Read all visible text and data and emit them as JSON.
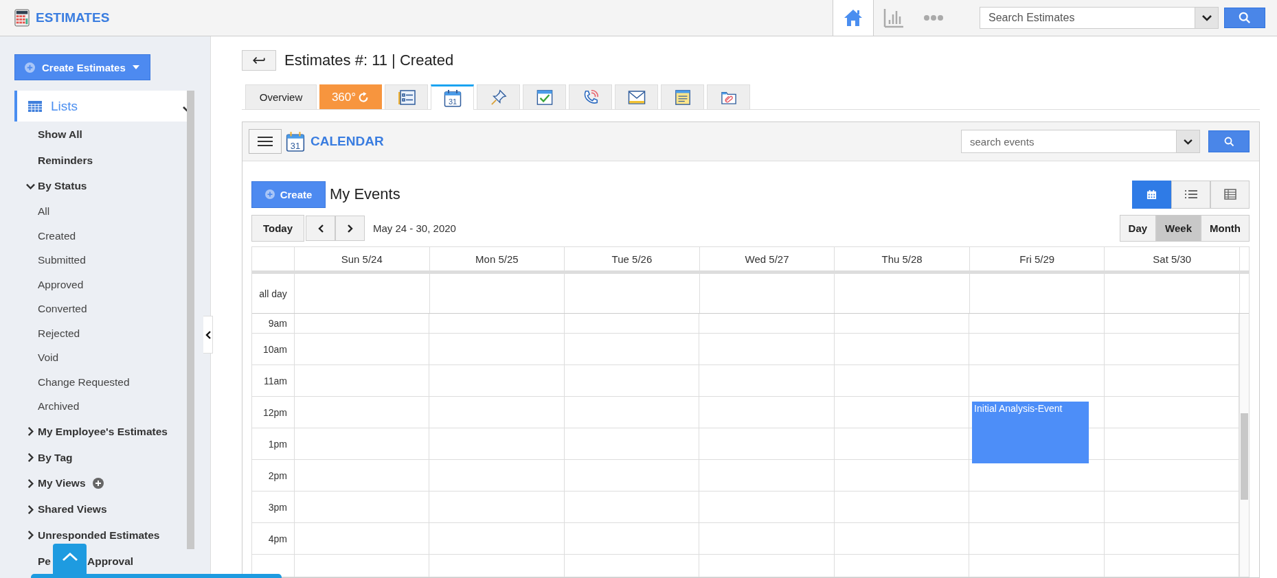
{
  "app": {
    "title": "ESTIMATES"
  },
  "topbar": {
    "nav": [
      {
        "kind": "home",
        "selected": true
      },
      {
        "kind": "chart",
        "selected": false
      },
      {
        "kind": "more",
        "selected": false
      }
    ],
    "search": {
      "placeholder": "Search Estimates"
    }
  },
  "sidebar": {
    "create_button": "Create Estimates",
    "section": {
      "label": "Lists",
      "expanded": true
    },
    "items": [
      {
        "label": "Show All",
        "kind": "link"
      },
      {
        "label": "Reminders",
        "kind": "link"
      },
      {
        "label": "By Status",
        "kind": "group",
        "expanded": true,
        "children": [
          {
            "label": "All"
          },
          {
            "label": "Created"
          },
          {
            "label": "Submitted"
          },
          {
            "label": "Approved"
          },
          {
            "label": "Converted"
          },
          {
            "label": "Rejected"
          },
          {
            "label": "Void"
          },
          {
            "label": "Change Requested"
          },
          {
            "label": "Archived"
          }
        ]
      },
      {
        "label": "My Employee's Estimates",
        "kind": "group",
        "expanded": false
      },
      {
        "label": "By Tag",
        "kind": "group",
        "expanded": false
      },
      {
        "label": "My Views",
        "kind": "group",
        "expanded": false,
        "addable": true
      },
      {
        "label": "Shared Views",
        "kind": "group",
        "expanded": false
      },
      {
        "label": "Unresponded Estimates",
        "kind": "group",
        "expanded": false
      },
      {
        "label_parts": [
          "Pe",
          "Approval"
        ],
        "kind": "covered"
      }
    ]
  },
  "record": {
    "title": "Estimates #: 11 | Created"
  },
  "tabs": [
    {
      "kind": "text",
      "label": "Overview",
      "selected": false
    },
    {
      "kind": "rotate",
      "label": "360°",
      "selected": false
    },
    {
      "kind": "details",
      "selected": false
    },
    {
      "kind": "calendar",
      "icon_text": "31",
      "selected": true
    },
    {
      "kind": "pin",
      "selected": false
    },
    {
      "kind": "task",
      "selected": false
    },
    {
      "kind": "call",
      "selected": false
    },
    {
      "kind": "mail",
      "selected": false
    },
    {
      "kind": "note",
      "selected": false
    },
    {
      "kind": "attachment",
      "selected": false
    }
  ],
  "calendar": {
    "title": "CALENDAR",
    "icon_text": "31",
    "search": {
      "placeholder": "search events"
    },
    "create_button": "Create",
    "heading": "My Events",
    "views": [
      {
        "kind": "calendar",
        "selected": true
      },
      {
        "kind": "list",
        "selected": false
      },
      {
        "kind": "table",
        "selected": false
      }
    ],
    "today_button": "Today",
    "range": "May 24 - 30, 2020",
    "range_modes": [
      {
        "label": "Day",
        "selected": false
      },
      {
        "label": "Week",
        "selected": true
      },
      {
        "label": "Month",
        "selected": false
      }
    ],
    "all_day_label": "all day",
    "days": [
      {
        "label": "Sun 5/24"
      },
      {
        "label": "Mon 5/25"
      },
      {
        "label": "Tue 5/26"
      },
      {
        "label": "Wed 5/27"
      },
      {
        "label": "Thu 5/28"
      },
      {
        "label": "Fri 5/29",
        "events": [
          {
            "title": "Initial Analysis-Event"
          }
        ]
      },
      {
        "label": "Sat 5/30"
      }
    ],
    "times": [
      "9am",
      "10am",
      "11am",
      "12pm",
      "1pm",
      "2pm",
      "3pm",
      "4pm"
    ]
  }
}
